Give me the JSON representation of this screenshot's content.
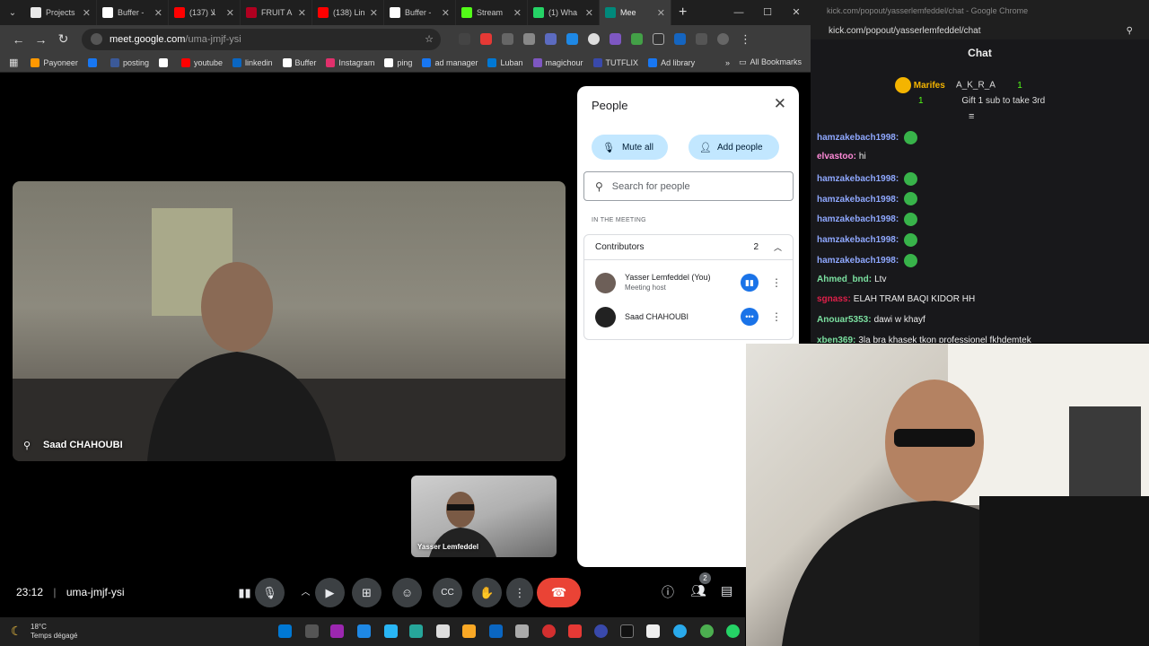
{
  "browser": {
    "tabs": [
      {
        "label": "Projects",
        "color": "#e8e8e8"
      },
      {
        "label": "Buffer -",
        "color": "#ffffff"
      },
      {
        "label": "ﻼ (137)",
        "color": "#ff0000"
      },
      {
        "label": "FRUIT A",
        "color": "#b00020"
      },
      {
        "label": "(138) Lin",
        "color": "#ff0000"
      },
      {
        "label": "Buffer -",
        "color": "#ffffff"
      },
      {
        "label": "Stream",
        "color": "#53fc18"
      },
      {
        "label": "(1) Wha",
        "color": "#25d366"
      },
      {
        "label": "Mee",
        "color": "#00897b"
      }
    ],
    "url_host": "meet.google.com",
    "url_path": "/uma-jmjf-ysi",
    "bookmarks": [
      "Payoneer",
      "",
      "posting",
      "",
      "youtube",
      "linkedin",
      "Buffer",
      "Instagram",
      "ping",
      "ad manager",
      "Luban",
      "magichour",
      "TUTFLIX",
      "Ad library"
    ],
    "all_bookmarks": "All Bookmarks"
  },
  "meet": {
    "main_participant": "Saad CHAHOUBI",
    "self_name": "Yasser Lemfeddel",
    "clock": "23:12",
    "meeting_code": "uma-jmjf-ysi",
    "people_badge": "2"
  },
  "people_panel": {
    "title": "People",
    "mute_all": "Mute all",
    "add_people": "Add people",
    "search_placeholder": "Search for people",
    "section_label": "IN THE MEETING",
    "group_label": "Contributors",
    "group_count": "2",
    "participants": [
      {
        "name": "Yasser Lemfeddel (You)",
        "role": "Meeting host"
      },
      {
        "name": "Saad CHAHOUBI",
        "role": ""
      }
    ]
  },
  "kick": {
    "window_title": "kick.com/popout/yasserlemfeddel/chat - Google Chrome",
    "address": "kick.com/popout/yasserlemfeddel/chat",
    "chat_title": "Chat",
    "leader_first": "Marifes",
    "leader_first_count": "1",
    "leader_second": "A_K_R_A",
    "leader_second_count": "1",
    "gift_prompt": "Gift 1 sub to take 3rd",
    "messages": [
      {
        "user": "hamzakebach1998:",
        "text": "",
        "color": "#8fa8ff",
        "emote": true
      },
      {
        "user": "elvastoo:",
        "text": "hi",
        "color": "#ff8ad8",
        "emote": false
      },
      {
        "user": "hamzakebach1998:",
        "text": "",
        "color": "#8fa8ff",
        "emote": true
      },
      {
        "user": "hamzakebach1998:",
        "text": "",
        "color": "#8fa8ff",
        "emote": true
      },
      {
        "user": "hamzakebach1998:",
        "text": "",
        "color": "#8fa8ff",
        "emote": true
      },
      {
        "user": "hamzakebach1998:",
        "text": "",
        "color": "#8fa8ff",
        "emote": true
      },
      {
        "user": "hamzakebach1998:",
        "text": "",
        "color": "#8fa8ff",
        "emote": true
      },
      {
        "user": "Ahmed_bnd:",
        "text": "Ltv",
        "color": "#7be0a0",
        "emote": false
      },
      {
        "user": "sgnass:",
        "text": "ELAH TRAM BAQI KIDOR HH",
        "color": "#e0204a",
        "emote": false
      },
      {
        "user": "Anouar5353:",
        "text": "dawi w khayf",
        "color": "#7be0a0",
        "emote": false
      },
      {
        "user": "xben369:",
        "text": "3la bra khasek tkon professionel fkhdemtek",
        "color": "#7be0a0",
        "emote": false
      }
    ]
  },
  "taskbar": {
    "temperature": "18°C",
    "weather": "Temps dégagé"
  }
}
